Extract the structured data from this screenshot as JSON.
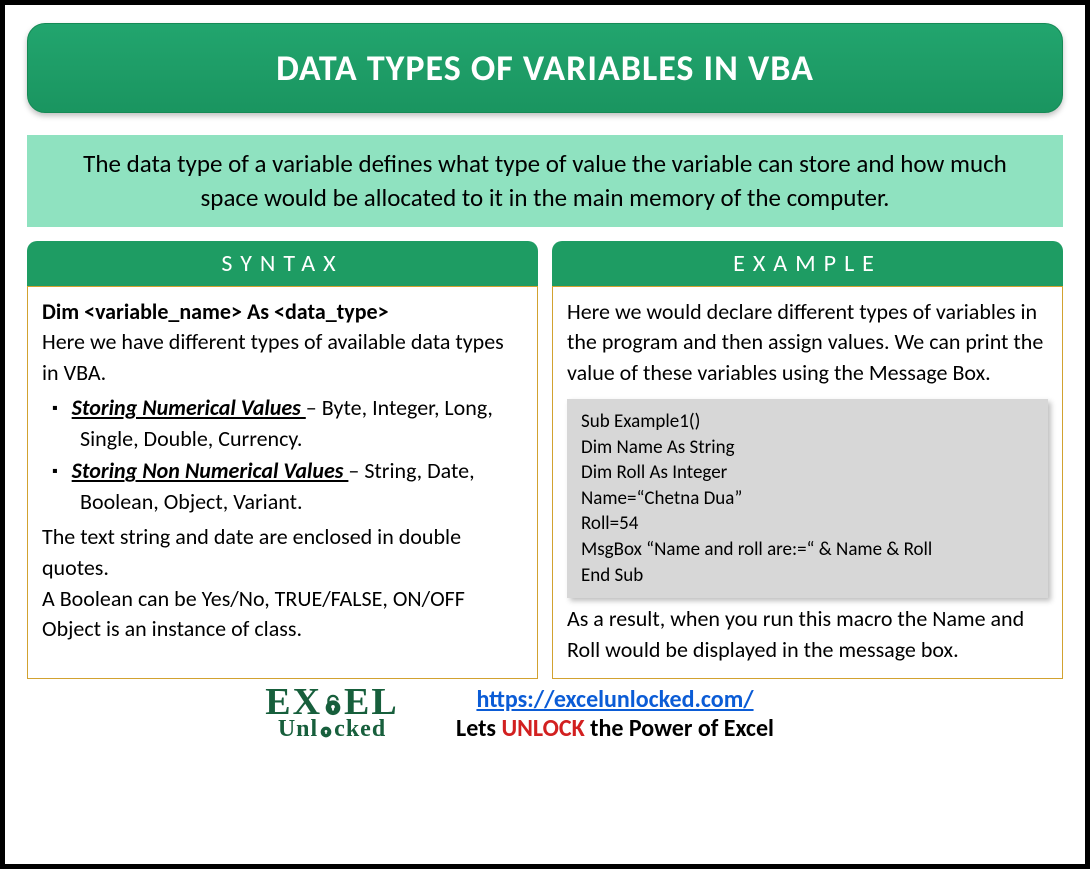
{
  "title": "DATA TYPES OF VARIABLES IN VBA",
  "subtitle": "The data type of a variable defines what type of value the variable can store and how much space would be allocated to it in the main memory of the computer.",
  "syntax": {
    "header": "SYNTAX",
    "declaration": "Dim <variable_name> As <data_type>",
    "intro": "Here we have different types of available data types in VBA.",
    "bullets": [
      {
        "title": "Storing Numerical Values ",
        "rest": "– Byte, Integer, Long, Single, Double, Currency."
      },
      {
        "title": "Storing Non Numerical Values ",
        "rest": "– String, Date, Boolean, Object, Variant."
      }
    ],
    "note1": "The text string and date are enclosed in double quotes.",
    "note2": "A Boolean can be Yes/No, TRUE/FALSE, ON/OFF",
    "note3": "Object is an instance of class."
  },
  "example": {
    "header": "EXAMPLE",
    "intro": "Here we would declare different types of variables in the program and then assign values. We can print the value of these variables using the Message Box.",
    "code": "Sub Example1()\nDim Name As String\nDim Roll As Integer\nName=“Chetna Dua”\nRoll=54\nMsgBox “Name and roll are:=“ & Name & Roll\nEnd Sub",
    "result": "As a result, when you run this macro the Name and Roll would be displayed in the message box."
  },
  "footer": {
    "url": "https://excelunlocked.com/",
    "tag_before": "Lets ",
    "tag_unlock": "UNLOCK",
    "tag_after": " the Power of Excel",
    "logo_top": "EX   EL",
    "logo_bottom": "Unl   cked"
  }
}
